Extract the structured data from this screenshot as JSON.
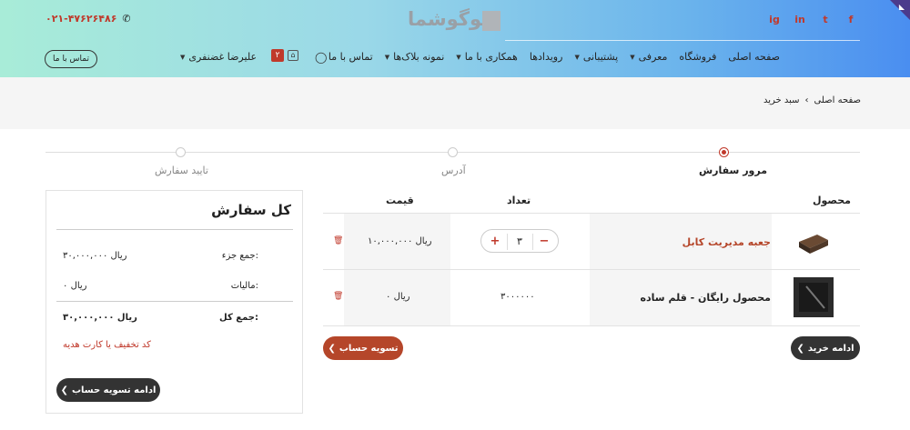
{
  "header": {
    "phone": "۰۲۱-۴۷۶۲۶۴۸۶",
    "logo_text": "لوگوشما",
    "social": [
      "f",
      "t",
      "in",
      "ig"
    ],
    "contact_button": "تماس با ما",
    "nav": [
      {
        "label": "صفحه اصلی",
        "caret": false
      },
      {
        "label": "فروشگاه",
        "caret": false
      },
      {
        "label": "معرفی",
        "caret": true
      },
      {
        "label": "پشتیبانی",
        "caret": true
      },
      {
        "label": "رویدادها",
        "caret": false
      },
      {
        "label": "همکاری با ما",
        "caret": true
      },
      {
        "label": "نمونه بلاک‌ها",
        "caret": true
      },
      {
        "label": "تماس با ما",
        "caret": false
      }
    ],
    "cart_count": "۲",
    "user_name": "علیرضا غضنفری"
  },
  "breadcrumb": {
    "home": "صفحه اصلی",
    "current": "سبد خرید"
  },
  "steps": [
    {
      "label": "مرور سفارش",
      "active": true
    },
    {
      "label": "آدرس",
      "active": false
    },
    {
      "label": "تایید سفارش",
      "active": false
    }
  ],
  "table": {
    "headers": {
      "product": "محصول",
      "quantity": "تعداد",
      "price": "قیمت"
    },
    "rows": [
      {
        "name": "جعبه مدیریت کابل",
        "quantity": "۳",
        "price": "۱۰,۰۰۰,۰۰۰ ریال"
      },
      {
        "name": "محصول رایگان - قلم ساده",
        "quantity": "۳۰۰۰۰۰۰",
        "price": "۰ ریال"
      }
    ]
  },
  "buttons": {
    "continue_shopping": "ادامه خرید",
    "checkout": "تسویه حساب",
    "continue_checkout": "ادامه تسویه حساب"
  },
  "summary": {
    "title": "کل سفارش",
    "subtotal_label": "جمع جزء:",
    "subtotal_value": "۳۰,۰۰۰,۰۰۰ ریال",
    "tax_label": "مالیات:",
    "tax_value": "۰ ریال",
    "total_label": "جمع کل:",
    "total_value": "۳۰,۰۰۰,۰۰۰ ریال",
    "coupon_link": "کد تخفیف یا کارت هدیه"
  },
  "colors": {
    "accent": "#c0392b",
    "dark_button": "#333333",
    "checkout_button": "#b5462a"
  }
}
